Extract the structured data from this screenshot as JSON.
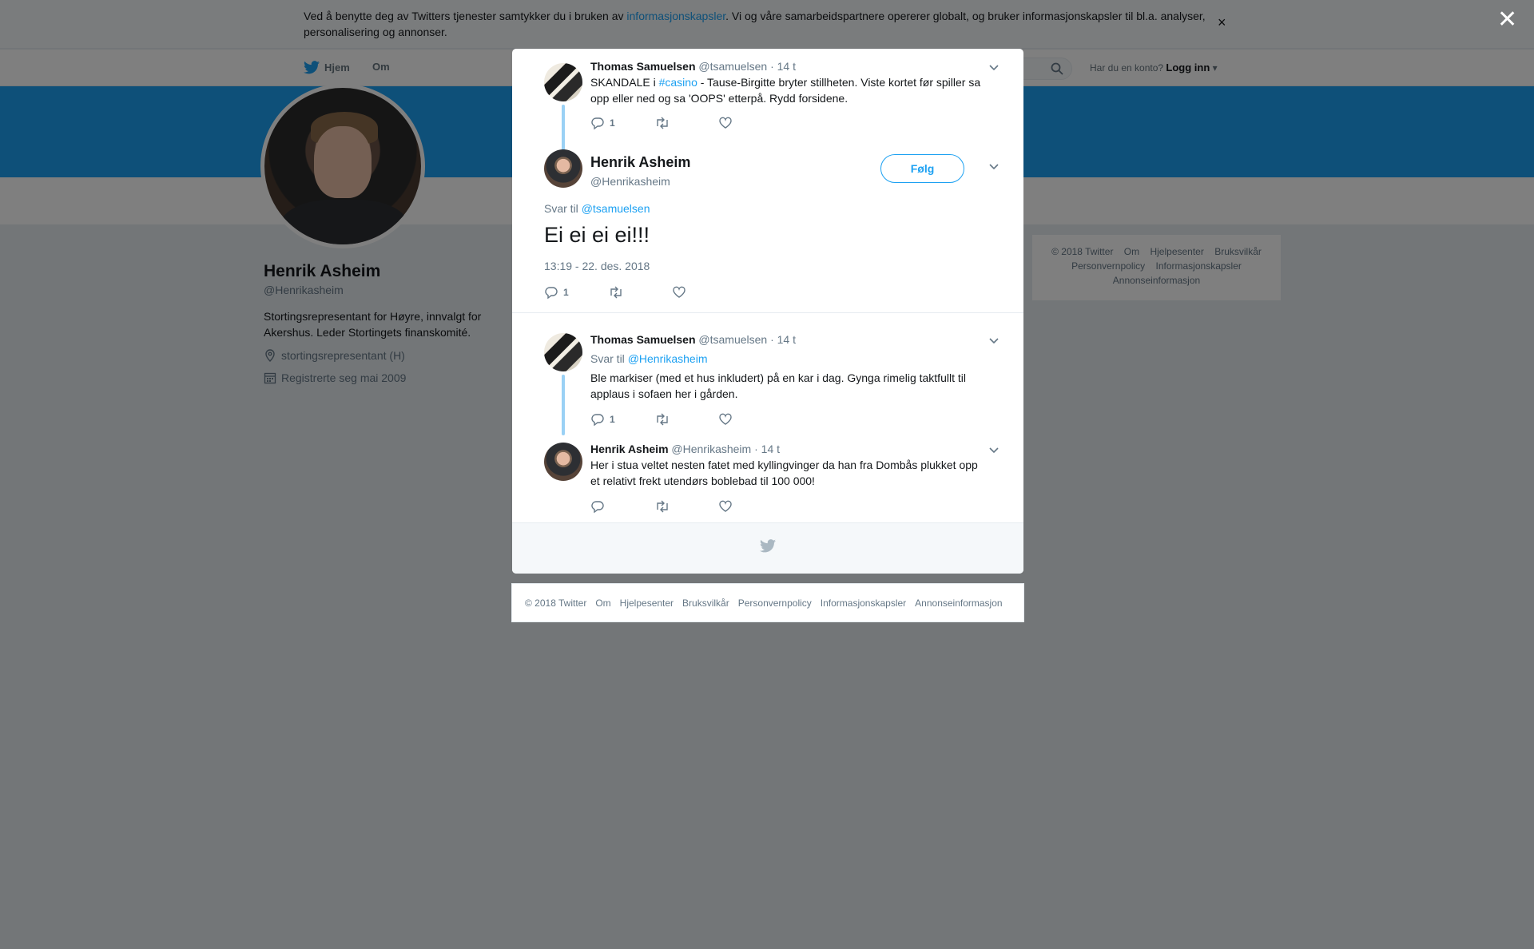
{
  "cookie": {
    "text_before": "Ved å benytte deg av Twitters tjenester samtykker du i bruken av ",
    "link": "informasjonskapsler",
    "text_after": ". Vi og våre samarbeidspartnere opererer globalt, og bruker informasjonskapsler til bl.a. analyser, personalisering og annonser.",
    "close": "×"
  },
  "nav": {
    "home": "Hjem",
    "about": "Om",
    "login_prompt": "Har du en konto?",
    "login": "Logg inn"
  },
  "profile": {
    "name": "Henrik Asheim",
    "handle": "@Henrikasheim",
    "bio": "Stortingsrepresentant for Høyre, innvalgt for Akershus. Leder Stortingets finanskomité.",
    "location": "stortingsrepresentant (H)",
    "joined": "Registrerte seg mai 2009"
  },
  "side_footer": {
    "items": [
      "© 2018 Twitter",
      "Om",
      "Hjelpesenter",
      "Bruksvilkår",
      "Personvernpolicy",
      "Informasjonskapsler",
      "Annonseinformasjon"
    ]
  },
  "overlay": {
    "close": "✕"
  },
  "modal": {
    "tweet1": {
      "name": "Thomas Samuelsen",
      "handle": "@tsamuelsen",
      "time": "· 14 t",
      "text_before": "SKANDALE i ",
      "hashtag": "#casino",
      "text_after": " - Tause-Birgitte bryter stillheten. Viste kortet før spiller sa opp eller ned og sa 'OOPS' etterpå. Rydd forsidene.",
      "replies": "1"
    },
    "main": {
      "name": "Henrik Asheim",
      "handle": "@Henrikasheim",
      "follow": "Følg",
      "reply_to_label": "Svar til ",
      "reply_to_handle": "@tsamuelsen",
      "text": "Ei ei ei ei!!!",
      "timestamp": "13:19 - 22. des. 2018",
      "replies": "1"
    },
    "tweet3": {
      "name": "Thomas Samuelsen",
      "handle": "@tsamuelsen",
      "time": "· 14 t",
      "reply_to_label": "Svar til ",
      "reply_to_handle": "@Henrikasheim",
      "text": "Ble markiser (med et hus inkludert) på en kar i dag. Gynga rimelig taktfullt til applaus i sofaen her i gården.",
      "replies": "1"
    },
    "tweet4": {
      "name": "Henrik Asheim",
      "handle": "@Henrikasheim",
      "time": "· 14 t",
      "text": "Her i stua veltet nesten fatet med kyllingvinger da han fra Dombås plukket opp et relativt frekt utendørs boblebad til 100 000!"
    }
  },
  "footer": {
    "items": [
      "© 2018 Twitter",
      "Om",
      "Hjelpesenter",
      "Bruksvilkår",
      "Personvernpolicy",
      "Informasjonskapsler",
      "Annonseinformasjon"
    ]
  },
  "colors": {
    "accent": "#1da1f2",
    "thread": "#9ad1f5",
    "muted": "#657786"
  }
}
